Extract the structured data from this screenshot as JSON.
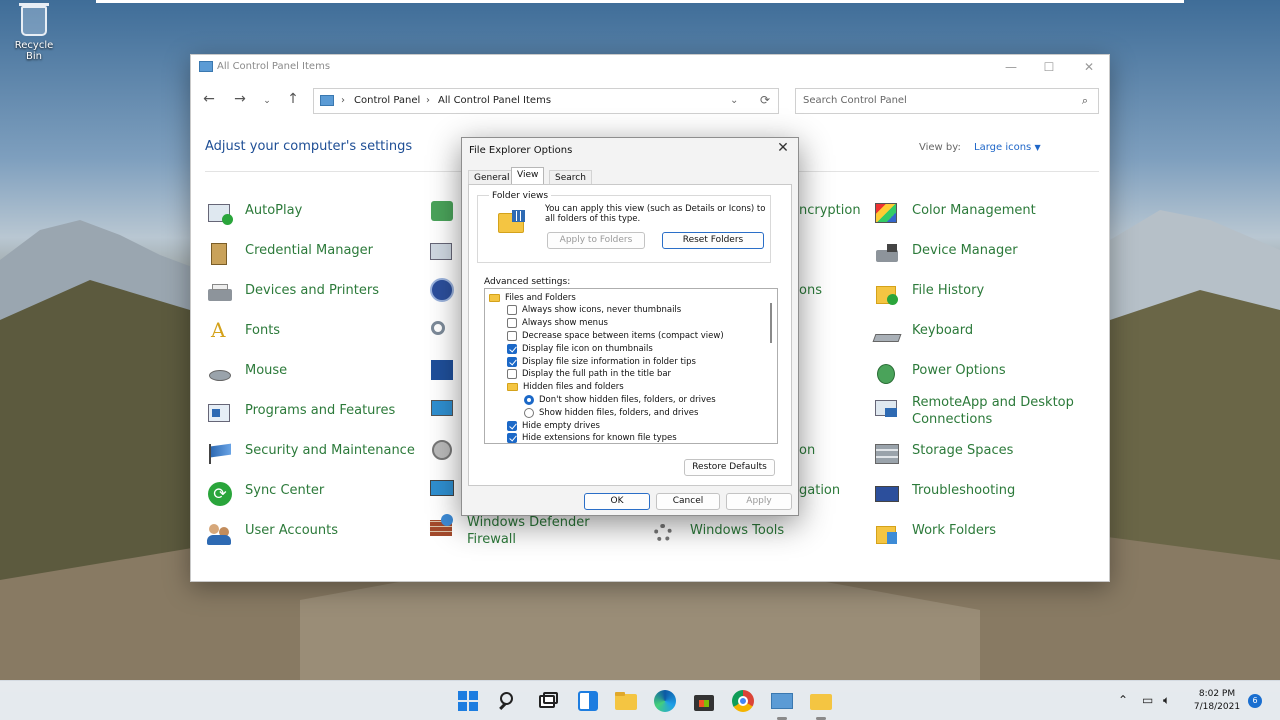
{
  "desktop": {
    "recycle_bin": "Recycle Bin"
  },
  "window": {
    "title": "All Control Panel Items",
    "breadcrumb": [
      "Control Panel",
      "All Control Panel Items"
    ],
    "search_placeholder": "Search Control Panel",
    "heading": "Adjust your computer's settings",
    "view_by_label": "View by:",
    "view_by_value": "Large icons",
    "items": {
      "autoplay": "AutoPlay",
      "credential_manager": "Credential Manager",
      "devices_printers": "Devices and Printers",
      "fonts": "Fonts",
      "mouse": "Mouse",
      "programs_features": "Programs and Features",
      "security_maintenance": "Security and Maintenance",
      "sync_center": "Sync Center",
      "user_accounts": "User Accounts",
      "windows_defender_firewall": [
        "Windows Defender",
        "Firewall"
      ],
      "windows_tools": "Windows Tools",
      "partial_encryption": "ncryption",
      "partial_ons": "ons",
      "partial_on": "on",
      "partial_gation": "gation",
      "color_management": "Color Management",
      "device_manager": "Device Manager",
      "file_history": "File History",
      "keyboard": "Keyboard",
      "power_options": "Power Options",
      "remoteapp": [
        "RemoteApp and Desktop",
        "Connections"
      ],
      "storage_spaces": "Storage Spaces",
      "troubleshooting": "Troubleshooting",
      "work_folders": "Work Folders"
    }
  },
  "dialog": {
    "title": "File Explorer Options",
    "tabs": [
      "General",
      "View",
      "Search"
    ],
    "active_tab": "View",
    "folder_views_label": "Folder views",
    "folder_views_desc": "You can apply this view (such as Details or Icons) to all folders of this type.",
    "apply_to_folders": "Apply to Folders",
    "reset_folders": "Reset Folders",
    "advanced_label": "Advanced settings:",
    "advanced_items": [
      {
        "type": "folder",
        "label": "Files and Folders",
        "indent": 0
      },
      {
        "type": "checkbox",
        "label": "Always show icons, never thumbnails",
        "checked": false,
        "indent": 1
      },
      {
        "type": "checkbox",
        "label": "Always show menus",
        "checked": false,
        "indent": 1
      },
      {
        "type": "checkbox",
        "label": "Decrease space between items (compact view)",
        "checked": false,
        "indent": 1
      },
      {
        "type": "checkbox",
        "label": "Display file icon on thumbnails",
        "checked": true,
        "indent": 1
      },
      {
        "type": "checkbox",
        "label": "Display file size information in folder tips",
        "checked": true,
        "indent": 1
      },
      {
        "type": "checkbox",
        "label": "Display the full path in the title bar",
        "checked": false,
        "indent": 1
      },
      {
        "type": "folder",
        "label": "Hidden files and folders",
        "indent": 1
      },
      {
        "type": "radio",
        "label": "Don't show hidden files, folders, or drives",
        "checked": true,
        "indent": 2
      },
      {
        "type": "radio",
        "label": "Show hidden files, folders, and drives",
        "checked": false,
        "indent": 2
      },
      {
        "type": "checkbox",
        "label": "Hide empty drives",
        "checked": true,
        "indent": 1
      },
      {
        "type": "checkbox",
        "label": "Hide extensions for known file types",
        "checked": true,
        "indent": 1
      }
    ],
    "restore_defaults": "Restore Defaults",
    "ok": "OK",
    "cancel": "Cancel",
    "apply": "Apply"
  },
  "taskbar": {
    "time": "8:02 PM",
    "date": "7/18/2021",
    "notification_count": "6"
  }
}
